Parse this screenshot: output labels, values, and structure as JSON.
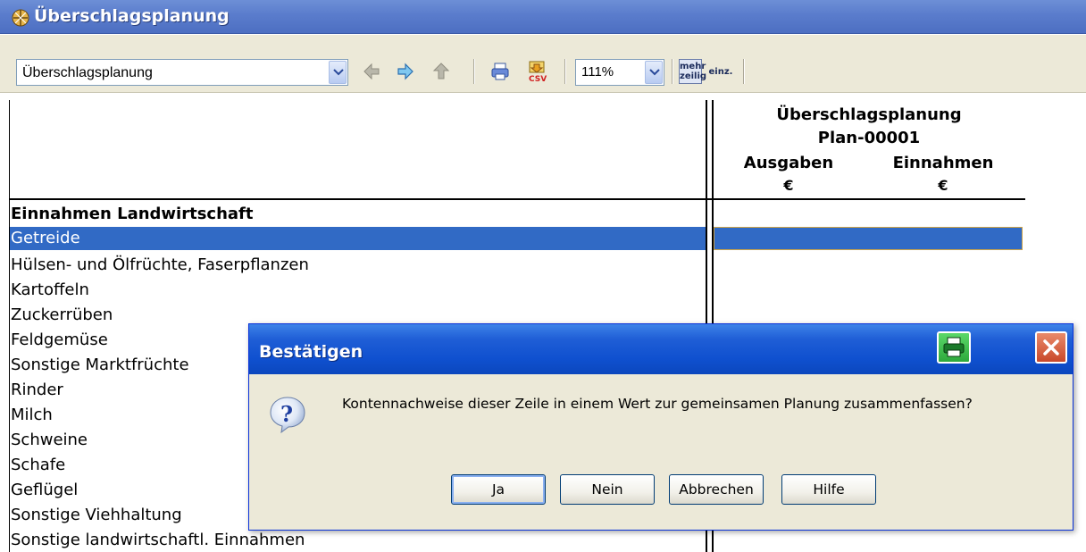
{
  "window": {
    "title": "Überschlagsplanung"
  },
  "toolbar": {
    "view_select": "Überschlagsplanung",
    "zoom": "111%",
    "mehr_label_1": "mehr",
    "mehr_label_2": "zeilig",
    "einz_label": "einz."
  },
  "report": {
    "header_title": "Überschlagsplanung",
    "header_plan": "Plan-00001",
    "col_expenses": "Ausgaben",
    "col_income": "Einnahmen",
    "currency_1": "€",
    "currency_2": "€",
    "section_title": "Einnahmen Landwirtschaft",
    "rows": [
      "Getreide",
      "Hülsen- und Ölfrüchte, Faserpflanzen",
      "Kartoffeln",
      "Zuckerrüben",
      "Feldgemüse",
      "Sonstige Marktfrüchte",
      "Rinder",
      "Milch",
      "Schweine",
      "Schafe",
      "Geflügel",
      "Sonstige Viehhaltung",
      "Sonstige landwirtschaftl. Einnahmen"
    ],
    "selected_row": "Getreide"
  },
  "dialog": {
    "title": "Bestätigen",
    "message": "Kontennachweise dieser Zeile in einem Wert zur gemeinsamen Planung zusammenfassen?",
    "buttons": {
      "yes": "Ja",
      "no": "Nein",
      "cancel": "Abbrechen",
      "help": "Hilfe"
    }
  },
  "colors": {
    "selection": "#316ac5",
    "title_bar": "#5a7ccc",
    "dialog_title": "#0f50cf",
    "dialog_bg": "#ece9d8"
  }
}
